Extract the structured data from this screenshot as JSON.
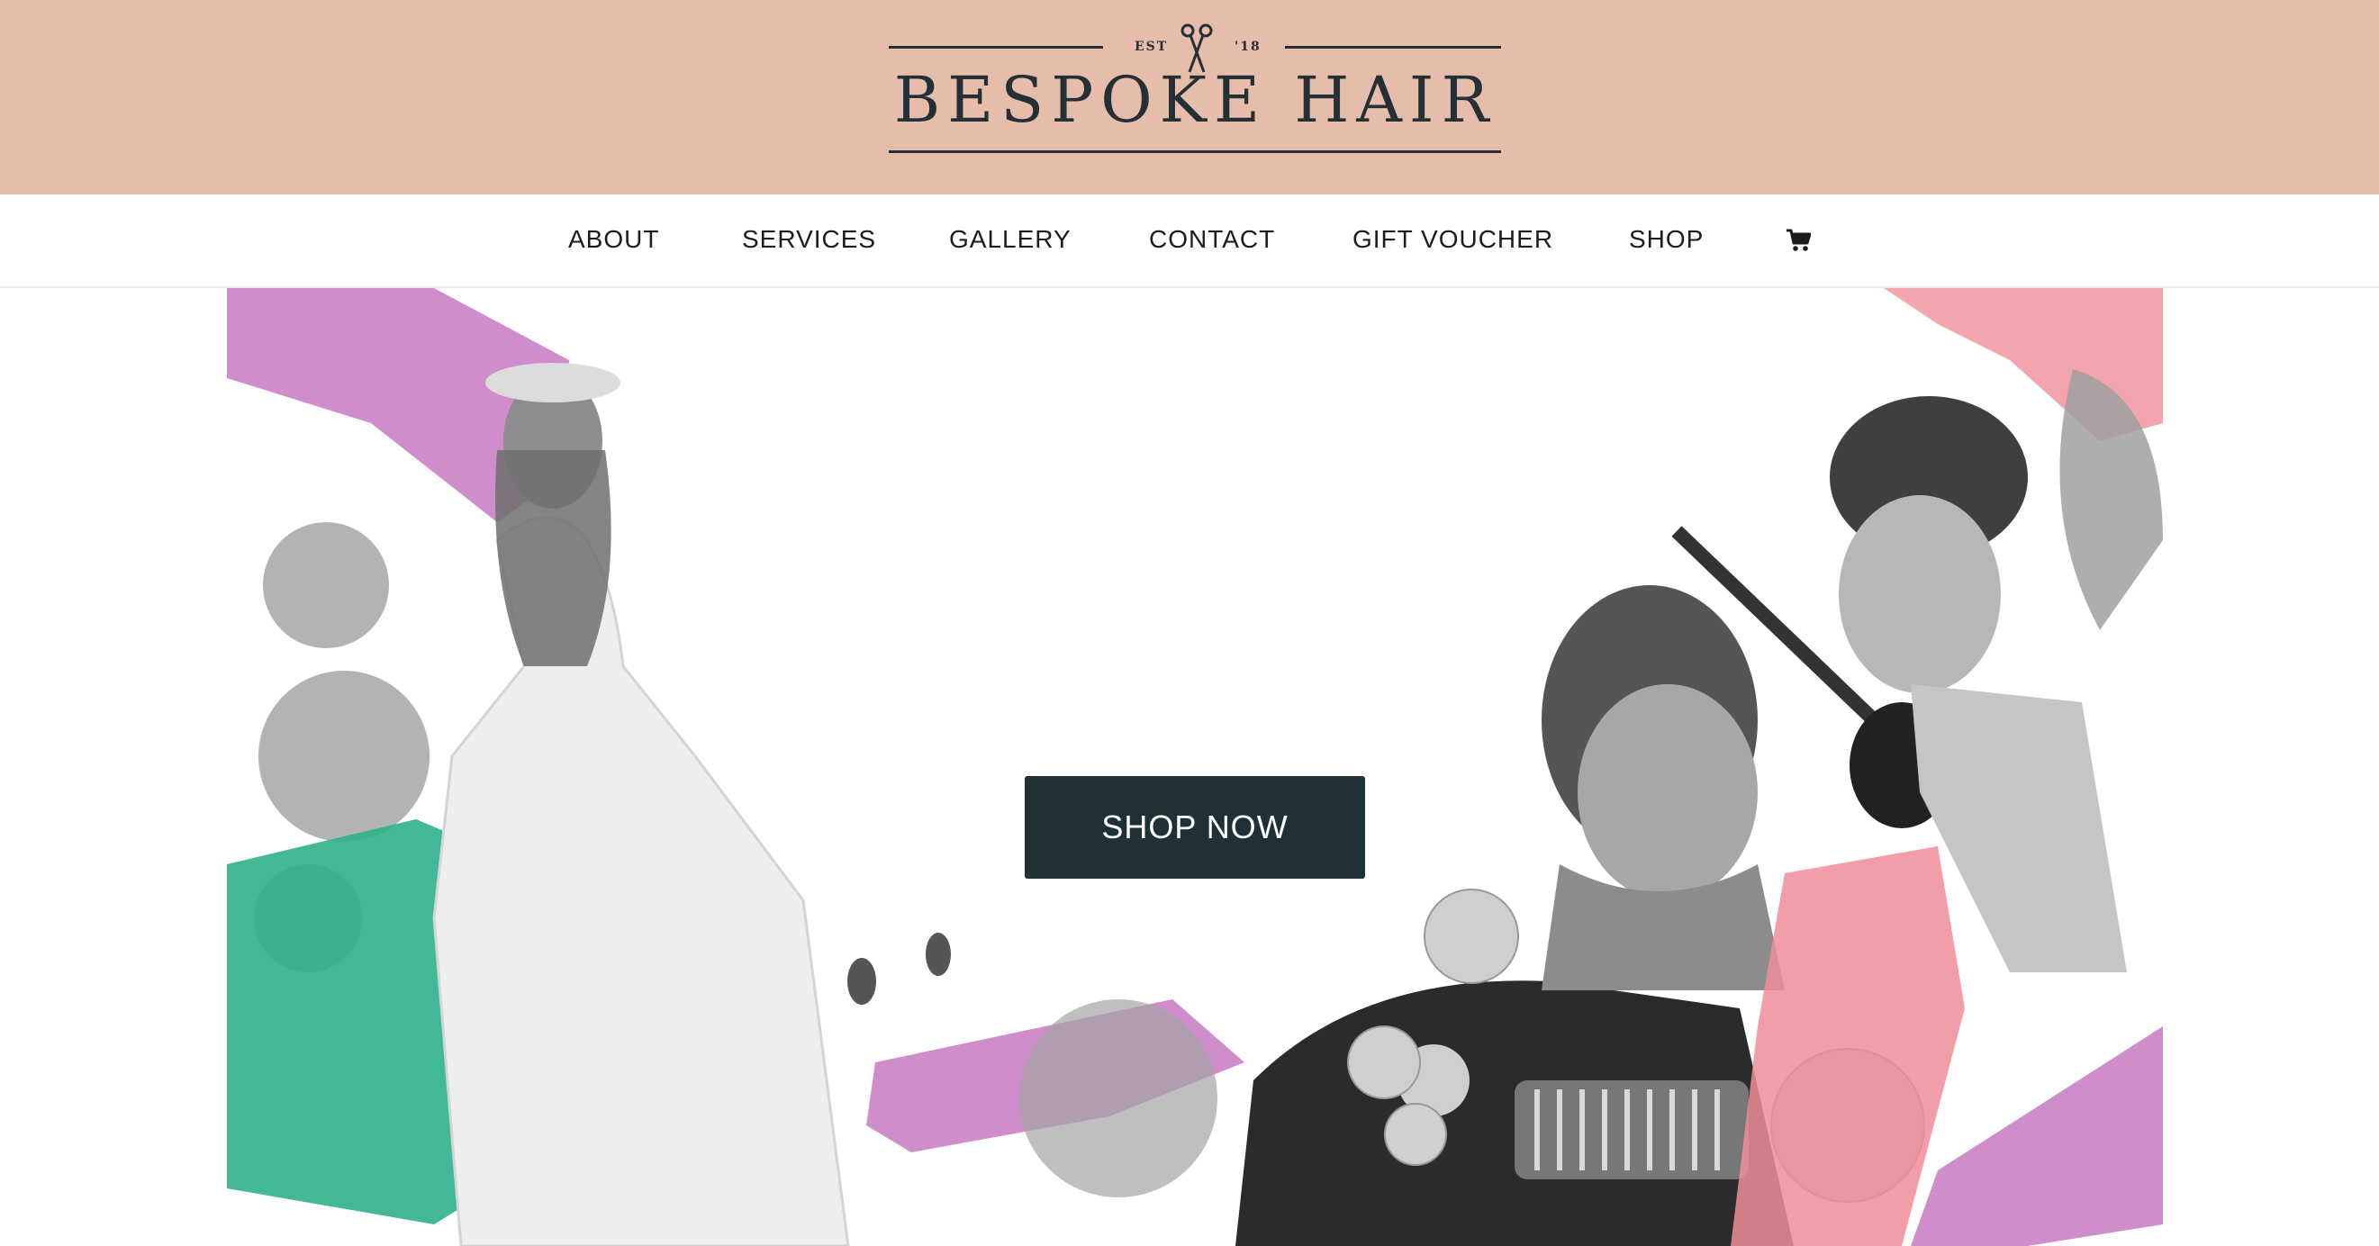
{
  "brand": {
    "est": "EST",
    "year": "'18",
    "name": "BESPOKE HAIR",
    "colors": {
      "header_bg": "#e6bdaa",
      "ink": "#243036"
    }
  },
  "nav": {
    "items": [
      {
        "label": "ABOUT"
      },
      {
        "label": "SERVICES"
      },
      {
        "label": "GALLERY"
      },
      {
        "label": "CONTACT"
      },
      {
        "label": "GIFT VOUCHER"
      },
      {
        "label": "SHOP"
      }
    ],
    "cart_icon": "cart-icon"
  },
  "hero": {
    "cta_label": "SHOP NOW",
    "cta_color": "#203136",
    "accent_colors": {
      "purple": "#c77ac2",
      "green": "#2fb08c",
      "pink": "#f08d99"
    }
  }
}
